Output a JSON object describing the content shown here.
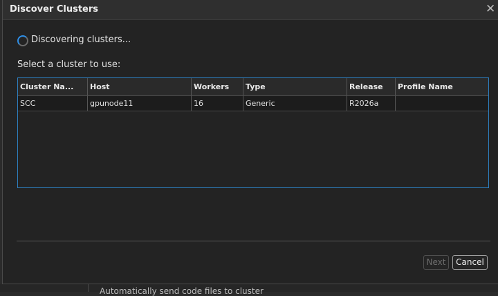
{
  "dialog": {
    "title": "Discover Clusters",
    "close_icon": "close-icon",
    "status_text": "Discovering clusters...",
    "prompt": "Select a cluster to use:",
    "accent_color": "#2e8ee6"
  },
  "table": {
    "columns": [
      "Cluster Na...",
      "Host",
      "Workers",
      "Type",
      "Release",
      "Profile Name"
    ],
    "rows": [
      [
        "SCC",
        "gpunode11",
        "16",
        "Generic",
        "R2026a",
        ""
      ]
    ]
  },
  "buttons": {
    "next_label": "Next",
    "cancel_label": "Cancel"
  },
  "background": {
    "partial_text": "Automatically send code files to cluster"
  }
}
